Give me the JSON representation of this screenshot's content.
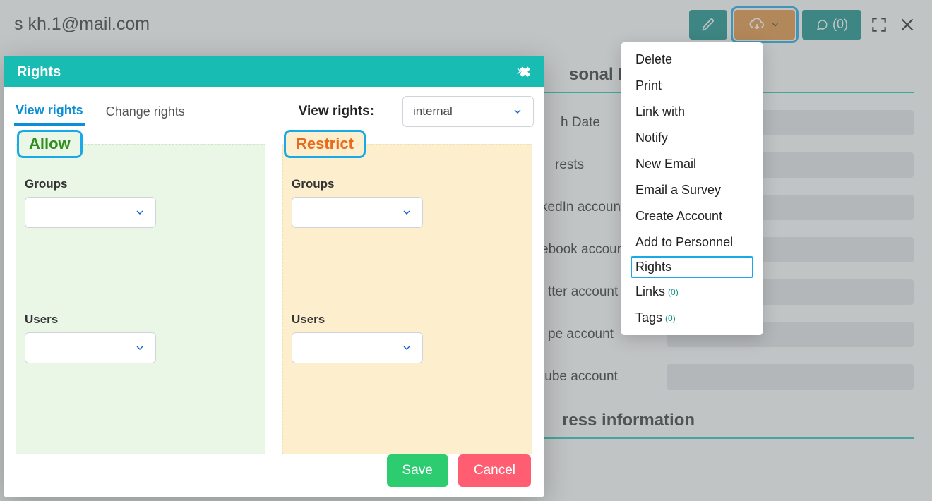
{
  "header": {
    "email_prefix": "s ",
    "email": "kh.1@mail.com",
    "comments_label": "(0)"
  },
  "menu": {
    "items": [
      {
        "label": "Delete",
        "hl": false,
        "sup": null
      },
      {
        "label": "Print",
        "hl": false,
        "sup": null
      },
      {
        "label": "Link with",
        "hl": false,
        "sup": null
      },
      {
        "label": "Notify",
        "hl": false,
        "sup": null
      },
      {
        "label": "New Email",
        "hl": false,
        "sup": null
      },
      {
        "label": "Email a Survey",
        "hl": false,
        "sup": null
      },
      {
        "label": "Create Account",
        "hl": false,
        "sup": null
      },
      {
        "label": "Add to Personnel",
        "hl": false,
        "sup": null
      },
      {
        "label": "Rights",
        "hl": true,
        "sup": null
      },
      {
        "label": "Links",
        "hl": false,
        "sup": "(0)"
      },
      {
        "label": "Tags",
        "hl": false,
        "sup": "(0)"
      }
    ]
  },
  "right": {
    "section1_title": "sonal Info",
    "fields": [
      "h Date",
      "rests",
      "kedIn account",
      "ebook account",
      "tter account",
      "pe account",
      "tube account"
    ],
    "section2_title": "ress information"
  },
  "modal": {
    "title": "Rights",
    "tabs": {
      "view": "View rights",
      "change": "Change rights"
    },
    "scope_label": "View rights:",
    "scope_value": "internal",
    "allow": {
      "title": "Allow",
      "groups": "Groups",
      "users": "Users"
    },
    "restrict": {
      "title": "Restrict",
      "groups": "Groups",
      "users": "Users"
    },
    "save": "Save",
    "cancel": "Cancel"
  }
}
